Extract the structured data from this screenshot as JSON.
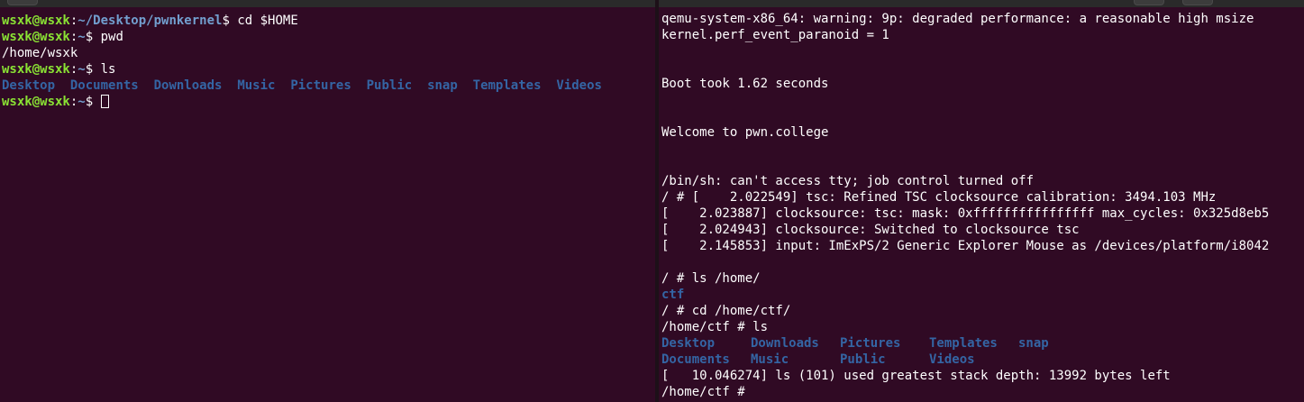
{
  "left_terminal": {
    "user_host": "wsxk@wsxk",
    "sep": ":",
    "home": "~",
    "cwd_initial": "~/Desktop/pwnkernel",
    "prompt_char": "$ ",
    "cmd1": "cd $HOME",
    "cmd2": "pwd",
    "pwd_output": "/home/wsxk",
    "cmd3": "ls",
    "ls_items": [
      "Desktop",
      "Documents",
      "Downloads",
      "Music",
      "Pictures",
      "Public",
      "snap",
      "Templates",
      "Videos"
    ]
  },
  "right_terminal": {
    "line1": "qemu-system-x86_64: warning: 9p: degraded performance: a reasonable high msize",
    "line2": "kernel.perf_event_paranoid = 1",
    "line3": "Boot took 1.62 seconds",
    "line4": "Welcome to pwn.college",
    "line5": "/bin/sh: can't access tty; job control turned off",
    "line6": "/ # [    2.022549] tsc: Refined TSC clocksource calibration: 3494.103 MHz",
    "line7": "[    2.023887] clocksource: tsc: mask: 0xffffffffffffffff max_cycles: 0x325d8eb5",
    "line8": "[    2.024943] clocksource: Switched to clocksource tsc",
    "line9": "[    2.145853] input: ImExPS/2 Generic Explorer Mouse as /devices/platform/i8042",
    "line10": "/ # ls /home/",
    "line11": "ctf",
    "line12": "/ # cd /home/ctf/",
    "line13": "/home/ctf # ls",
    "ls_row1": [
      "Desktop",
      "Downloads",
      "Pictures",
      "Templates",
      "snap"
    ],
    "ls_row2": [
      "Documents",
      "Music",
      "Public",
      "Videos"
    ],
    "line16": "[   10.046274] ls (101) used greatest stack depth: 13992 bytes left",
    "line17": "/home/ctf # "
  },
  "colors": {
    "background": "#300a24",
    "prompt_user": "#8ae234",
    "prompt_path": "#729fcf",
    "directory": "#3465a4"
  }
}
